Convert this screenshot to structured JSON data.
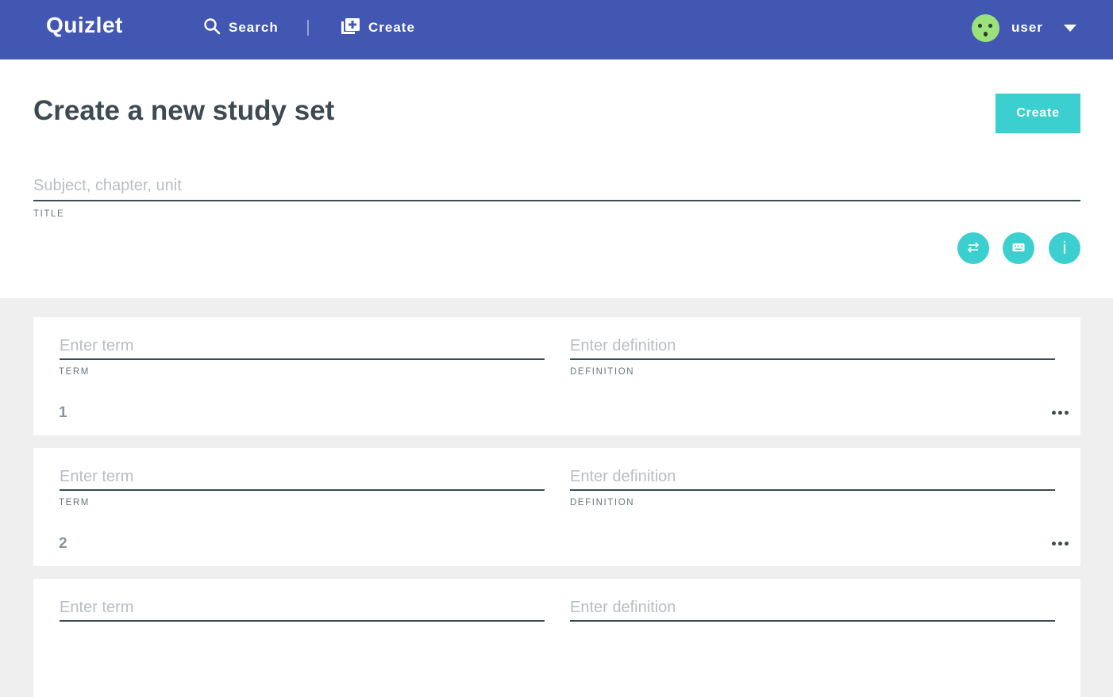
{
  "topbar": {
    "logo": "Quizlet",
    "search_label": "Search",
    "create_label": "Create",
    "user_name": "user",
    "background_color": "#4257b2"
  },
  "header": {
    "title": "Create a new study set",
    "create_button": "Create",
    "title_field": {
      "placeholder": "Subject, chapter, unit",
      "value": "",
      "label": "TITLE"
    },
    "action_icons": [
      "swap-icon",
      "keyboard-icon",
      "info-icon"
    ],
    "accent_color": "#3ccfcf"
  },
  "cards": [
    {
      "number": "1",
      "term_placeholder": "Enter term",
      "term_label": "TERM",
      "definition_placeholder": "Enter definition",
      "definition_label": "DEFINITION"
    },
    {
      "number": "2",
      "term_placeholder": "Enter term",
      "term_label": "TERM",
      "definition_placeholder": "Enter definition",
      "definition_label": "DEFINITION"
    },
    {
      "term_placeholder": "Enter term",
      "definition_placeholder": "Enter definition"
    }
  ]
}
